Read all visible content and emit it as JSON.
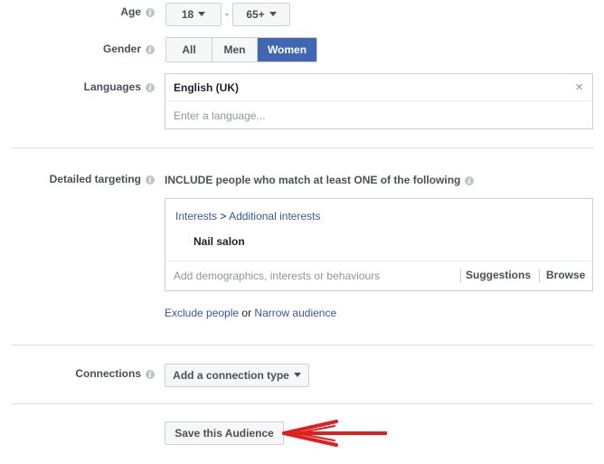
{
  "age": {
    "label": "Age",
    "min": "18",
    "separator": "-",
    "max": "65+"
  },
  "gender": {
    "label": "Gender",
    "options": [
      "All",
      "Men",
      "Women"
    ],
    "selected": "Women"
  },
  "languages": {
    "label": "Languages",
    "selected": "English (UK)",
    "remove_glyph": "×",
    "placeholder": "Enter a language..."
  },
  "detailed_targeting": {
    "label": "Detailed targeting",
    "include_text": "INCLUDE people who match at least ONE of the following",
    "path_category": "Interests",
    "path_separator": ">",
    "path_sub": "Additional interests",
    "item": "Nail salon",
    "placeholder": "Add demographics, interests or behaviours",
    "suggestions": "Suggestions",
    "browse": "Browse",
    "exclude_link": "Exclude people",
    "or_text": "or",
    "narrow_link": "Narrow audience"
  },
  "connections": {
    "label": "Connections",
    "dropdown": "Add a connection type"
  },
  "save_button": "Save this Audience",
  "colors": {
    "accent": "#4267b2",
    "link": "#365899",
    "arrow": "#e02020"
  }
}
